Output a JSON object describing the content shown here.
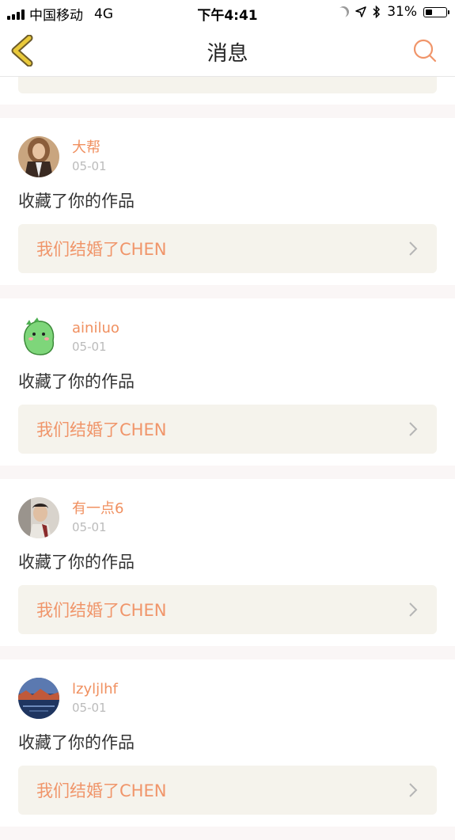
{
  "status_bar": {
    "carrier": "中国移动",
    "network": "4G",
    "time": "下午4:41",
    "battery": "31%"
  },
  "nav": {
    "title": "消息"
  },
  "messages": [
    {
      "username": "大帮",
      "date": "05-01",
      "action": "收藏了你的作品",
      "work_title": "我们结婚了CHEN"
    },
    {
      "username": "ainiluo",
      "date": "05-01",
      "action": "收藏了你的作品",
      "work_title": "我们结婚了CHEN"
    },
    {
      "username": "有一点6",
      "date": "05-01",
      "action": "收藏了你的作品",
      "work_title": "我们结婚了CHEN"
    },
    {
      "username": "lzyljlhf",
      "date": "05-01",
      "action": "收藏了你的作品",
      "work_title": "我们结婚了CHEN"
    }
  ],
  "colors": {
    "accent": "#f0956a",
    "card_bg": "#f5f3ec",
    "separator": "#faf6f6",
    "back_icon": "#e9c93a"
  }
}
